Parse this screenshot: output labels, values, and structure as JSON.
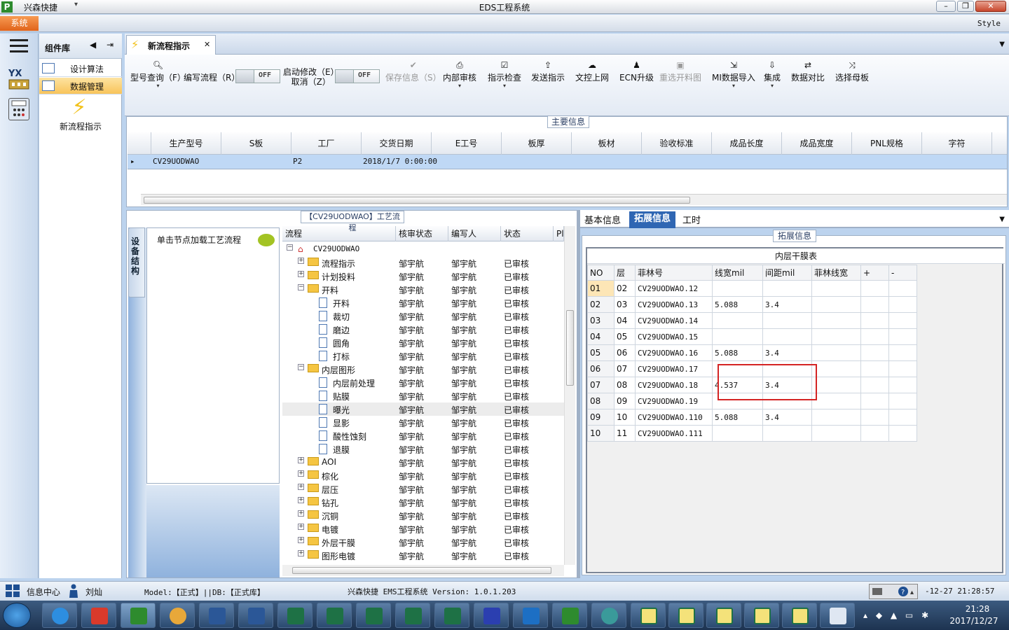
{
  "app": {
    "name": "兴森快捷",
    "window_title": "EDS工程系统",
    "logo": "P"
  },
  "menu": {
    "system": "系统",
    "style": "Style"
  },
  "components": {
    "title": "组件库",
    "items": [
      {
        "label": "设计算法"
      },
      {
        "label": "数据管理"
      }
    ],
    "new_flow": "新流程指示"
  },
  "tab": {
    "label": "新流程指示"
  },
  "ribbon": {
    "type_query": "型号查询（F）",
    "write_flow": "编写流程（R）",
    "toggle1": "OFF",
    "enable_edit_line1": "启动修改（E）",
    "enable_edit_line2": "取消（Z）",
    "toggle2": "OFF",
    "save_info": "保存信息（S）",
    "internal_review": "内部审核",
    "instruction_check": "指示检查",
    "send_instruction": "发送指示",
    "upload": "文控上网",
    "ecn_upgrade": "ECN升级",
    "reselect_drawing": "重选开料图",
    "mi_import": "MI数据导入",
    "integrate": "集成",
    "data_compare": "数据对比",
    "select_mother": "选择母板"
  },
  "main_info": {
    "title": "主要信息",
    "columns": [
      "生产型号",
      "S板",
      "工厂",
      "交货日期",
      "E工号",
      "板厚",
      "板材",
      "验收标准",
      "成品长度",
      "成品宽度",
      "PNL规格",
      "字符"
    ],
    "row": {
      "model": "CV29UODWAO",
      "factory": "P2",
      "delivery": "2018/1/7 0:00:00"
    }
  },
  "flow": {
    "title": "【CV29UODWAO】工艺流程",
    "side_tab": "设备结构",
    "hint": "单击节点加载工艺流程",
    "headers": [
      "流程",
      "核审状态",
      "编写人",
      "状态",
      "Pl"
    ],
    "root": "CV29UODWAO",
    "rows": [
      {
        "label": "流程指示",
        "reviewer": "邹宇航",
        "writer": "邹宇航",
        "status": "已审核"
      },
      {
        "label": "计划投料",
        "reviewer": "邹宇航",
        "writer": "邹宇航",
        "status": "已审核"
      },
      {
        "label": "开料",
        "reviewer": "邹宇航",
        "writer": "邹宇航",
        "status": "已审核"
      },
      {
        "label": "开料",
        "reviewer": "邹宇航",
        "writer": "邹宇航",
        "status": "已审核"
      },
      {
        "label": "裁切",
        "reviewer": "邹宇航",
        "writer": "邹宇航",
        "status": "已审核"
      },
      {
        "label": "磨边",
        "reviewer": "邹宇航",
        "writer": "邹宇航",
        "status": "已审核"
      },
      {
        "label": "圆角",
        "reviewer": "邹宇航",
        "writer": "邹宇航",
        "status": "已审核"
      },
      {
        "label": "打标",
        "reviewer": "邹宇航",
        "writer": "邹宇航",
        "status": "已审核"
      },
      {
        "label": "内层图形",
        "reviewer": "邹宇航",
        "writer": "邹宇航",
        "status": "已审核"
      },
      {
        "label": "内层前处理",
        "reviewer": "邹宇航",
        "writer": "邹宇航",
        "status": "已审核"
      },
      {
        "label": "贴膜",
        "reviewer": "邹宇航",
        "writer": "邹宇航",
        "status": "已审核"
      },
      {
        "label": "曝光",
        "reviewer": "邹宇航",
        "writer": "邹宇航",
        "status": "已审核"
      },
      {
        "label": "显影",
        "reviewer": "邹宇航",
        "writer": "邹宇航",
        "status": "已审核"
      },
      {
        "label": "酸性蚀刻",
        "reviewer": "邹宇航",
        "writer": "邹宇航",
        "status": "已审核"
      },
      {
        "label": "退膜",
        "reviewer": "邹宇航",
        "writer": "邹宇航",
        "status": "已审核"
      },
      {
        "label": "AOI",
        "reviewer": "邹宇航",
        "writer": "邹宇航",
        "status": "已审核"
      },
      {
        "label": "棕化",
        "reviewer": "邹宇航",
        "writer": "邹宇航",
        "status": "已审核"
      },
      {
        "label": "层压",
        "reviewer": "邹宇航",
        "writer": "邹宇航",
        "status": "已审核"
      },
      {
        "label": "钻孔",
        "reviewer": "邹宇航",
        "writer": "邹宇航",
        "status": "已审核"
      },
      {
        "label": "沉铜",
        "reviewer": "邹宇航",
        "writer": "邹宇航",
        "status": "已审核"
      },
      {
        "label": "电镀",
        "reviewer": "邹宇航",
        "writer": "邹宇航",
        "status": "已审核"
      },
      {
        "label": "外层干膜",
        "reviewer": "邹宇航",
        "writer": "邹宇航",
        "status": "已审核"
      },
      {
        "label": "图形电镀",
        "reviewer": "邹宇航",
        "writer": "邹宇航",
        "status": "已审核"
      }
    ]
  },
  "ext": {
    "tabs": [
      "基本信息",
      "拓展信息",
      "工时"
    ],
    "title": "拓展信息",
    "table_title": "内层干膜表",
    "headers": [
      "NO",
      "层",
      "菲林号",
      "线宽mil",
      "间距mil",
      "菲林线宽",
      "+",
      "-"
    ],
    "rows": [
      [
        "01",
        "02",
        "CV29UODWAO.12",
        "",
        ""
      ],
      [
        "02",
        "03",
        "CV29UODWAO.13",
        "5.088",
        "3.4"
      ],
      [
        "03",
        "04",
        "CV29UODWAO.14",
        "",
        ""
      ],
      [
        "04",
        "05",
        "CV29UODWAO.15",
        "",
        ""
      ],
      [
        "05",
        "06",
        "CV29UODWAO.16",
        "5.088",
        "3.4"
      ],
      [
        "06",
        "07",
        "CV29UODWAO.17",
        "",
        ""
      ],
      [
        "07",
        "08",
        "CV29UODWAO.18",
        "4.537",
        "3.4"
      ],
      [
        "08",
        "09",
        "CV29UODWAO.19",
        "",
        ""
      ],
      [
        "09",
        "10",
        "CV29UODWAO.110",
        "5.088",
        "3.4"
      ],
      [
        "10",
        "11",
        "CV29UODWAO.111",
        "",
        ""
      ]
    ]
  },
  "status": {
    "info_center": "信息中心",
    "user": "刘灿",
    "model_db": "Model:【正式】||DB:【正式库】",
    "version": "兴森快捷 EMS工程系统 Version: 1.0.1.203",
    "datetime": "-12-27 21:28:57"
  },
  "taskbar": {
    "time": "21:28",
    "date": "2017/12/27"
  },
  "colors": {
    "accent": "#2f66b3",
    "highlight": "#d42424",
    "orange": "#e0631a"
  }
}
